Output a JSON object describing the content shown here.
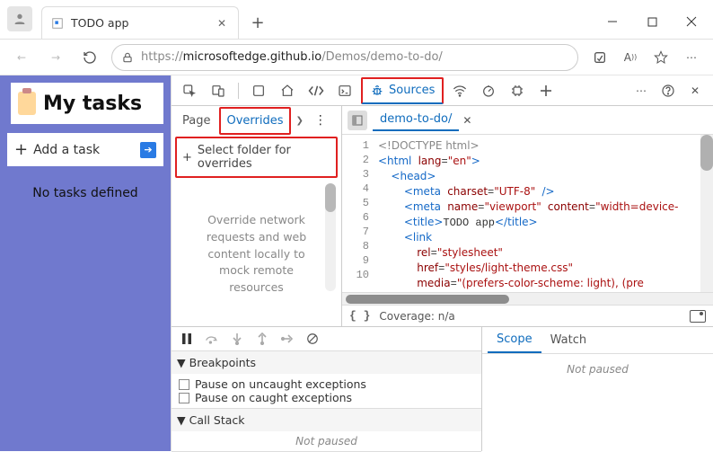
{
  "browser": {
    "tab_title": "TODO app",
    "url_prefix": "https://",
    "url_domain": "microsoftedge.github.io",
    "url_path": "/Demos/demo-to-do/"
  },
  "page": {
    "heading": "My tasks",
    "add_label": "Add a task",
    "empty_label": "No tasks defined"
  },
  "devtools": {
    "sources_tab": "Sources",
    "panel_tabs": {
      "page": "Page",
      "overrides": "Overrides"
    },
    "select_folder": "Select folder for overrides",
    "help_text": "Override network requests and web content locally to mock remote resources",
    "open_file": "demo-to-do/",
    "coverage_label": "Coverage: n/a",
    "code_lines": [
      "<!DOCTYPE html>",
      "<html lang=\"en\">",
      "  <head>",
      "    <meta charset=\"UTF-8\" />",
      "    <meta name=\"viewport\" content=\"width=device-",
      "    <title>TODO app</title>",
      "    <link",
      "      rel=\"stylesheet\"",
      "      href=\"styles/light-theme.css\"",
      "      media=\"(prefers-color-scheme: light), (pre"
    ]
  },
  "debugger": {
    "sections": {
      "breakpoints": "Breakpoints",
      "callstack": "Call Stack"
    },
    "pause_uncaught": "Pause on uncaught exceptions",
    "pause_caught": "Pause on caught exceptions",
    "not_paused": "Not paused",
    "scope_tab": "Scope",
    "watch_tab": "Watch"
  }
}
